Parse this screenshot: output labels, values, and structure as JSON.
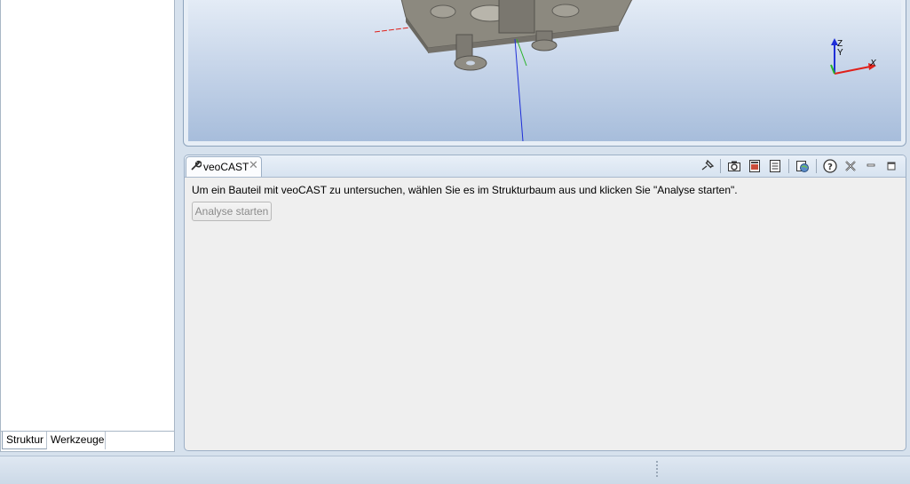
{
  "left_panel": {
    "tabs": [
      {
        "label": "Struktur",
        "active": true
      },
      {
        "label": "Werkzeuge",
        "active": false
      }
    ]
  },
  "viewport": {
    "axes": {
      "z": "Z",
      "y": "Y",
      "x": "X"
    }
  },
  "veocast": {
    "tab_title": "veoCAST",
    "tab_icon": "wrench-icon",
    "message": "Um ein Bauteil mit veoCAST zu untersuchen, wählen Sie es im Strukturbaum aus und klicken Sie \"Analyse starten\".",
    "button_label": "Analyse starten",
    "button_enabled": false,
    "toolbar_icons": [
      "pin-icon",
      "camera-icon",
      "export-image-icon",
      "report-icon",
      "globe-icon",
      "help-icon",
      "close-all-icon",
      "minimize-icon",
      "maximize-icon"
    ]
  },
  "colors": {
    "axis_x": "#e0201a",
    "axis_y": "#27b327",
    "axis_z": "#1e2ed8",
    "accent": "#d6e1ed"
  }
}
